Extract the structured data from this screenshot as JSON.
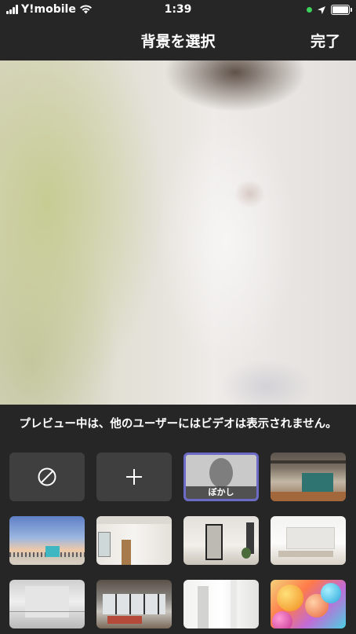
{
  "status_bar": {
    "carrier": "Y!mobile",
    "time": "1:39"
  },
  "navbar": {
    "title": "背景を選択",
    "done_label": "完了"
  },
  "notice": "プレビュー中は、他のユーザーにはビデオは表示されません。",
  "backgrounds": {
    "blur_label": "ぼかし"
  },
  "colors": {
    "background": "#262626",
    "tile": "#3f3f3f",
    "selected_border": "#6c6cc7",
    "recording_dot": "#3dd15e"
  }
}
